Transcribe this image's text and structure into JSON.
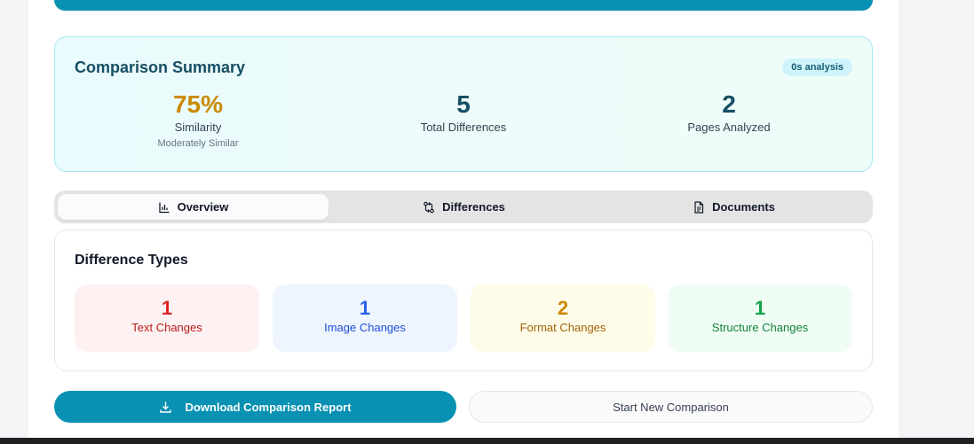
{
  "summary": {
    "title": "Comparison Summary",
    "analysis_badge": "0s analysis",
    "similarity": {
      "value": "75%",
      "label": "Similarity",
      "sublabel": "Moderately Similar"
    },
    "total_differences": {
      "value": "5",
      "label": "Total Differences"
    },
    "pages_analyzed": {
      "value": "2",
      "label": "Pages Analyzed"
    }
  },
  "tabs": [
    {
      "label": "Overview",
      "icon": "bar-chart-icon",
      "active": true
    },
    {
      "label": "Differences",
      "icon": "git-compare-icon",
      "active": false
    },
    {
      "label": "Documents",
      "icon": "document-icon",
      "active": false
    }
  ],
  "difference_types": {
    "title": "Difference Types",
    "items": [
      {
        "count": "1",
        "label": "Text Changes",
        "bg": "#fef1f1",
        "count_color": "#dc2626",
        "label_color": "#b91c1c"
      },
      {
        "count": "1",
        "label": "Image Changes",
        "bg": "#eff5ff",
        "count_color": "#2563eb",
        "label_color": "#1d4ed8"
      },
      {
        "count": "2",
        "label": "Format Changes",
        "bg": "#fefce8",
        "count_color": "#ca8a04",
        "label_color": "#a16207"
      },
      {
        "count": "1",
        "label": "Structure Changes",
        "bg": "#effdf4",
        "count_color": "#16a34a",
        "label_color": "#15803d"
      }
    ]
  },
  "actions": {
    "download_label": "Download Comparison Report",
    "new_comparison_label": "Start New Comparison"
  },
  "colors": {
    "accent": "#0891b2",
    "similarity": "#ca8a04",
    "stat_dark": "#164e63"
  }
}
